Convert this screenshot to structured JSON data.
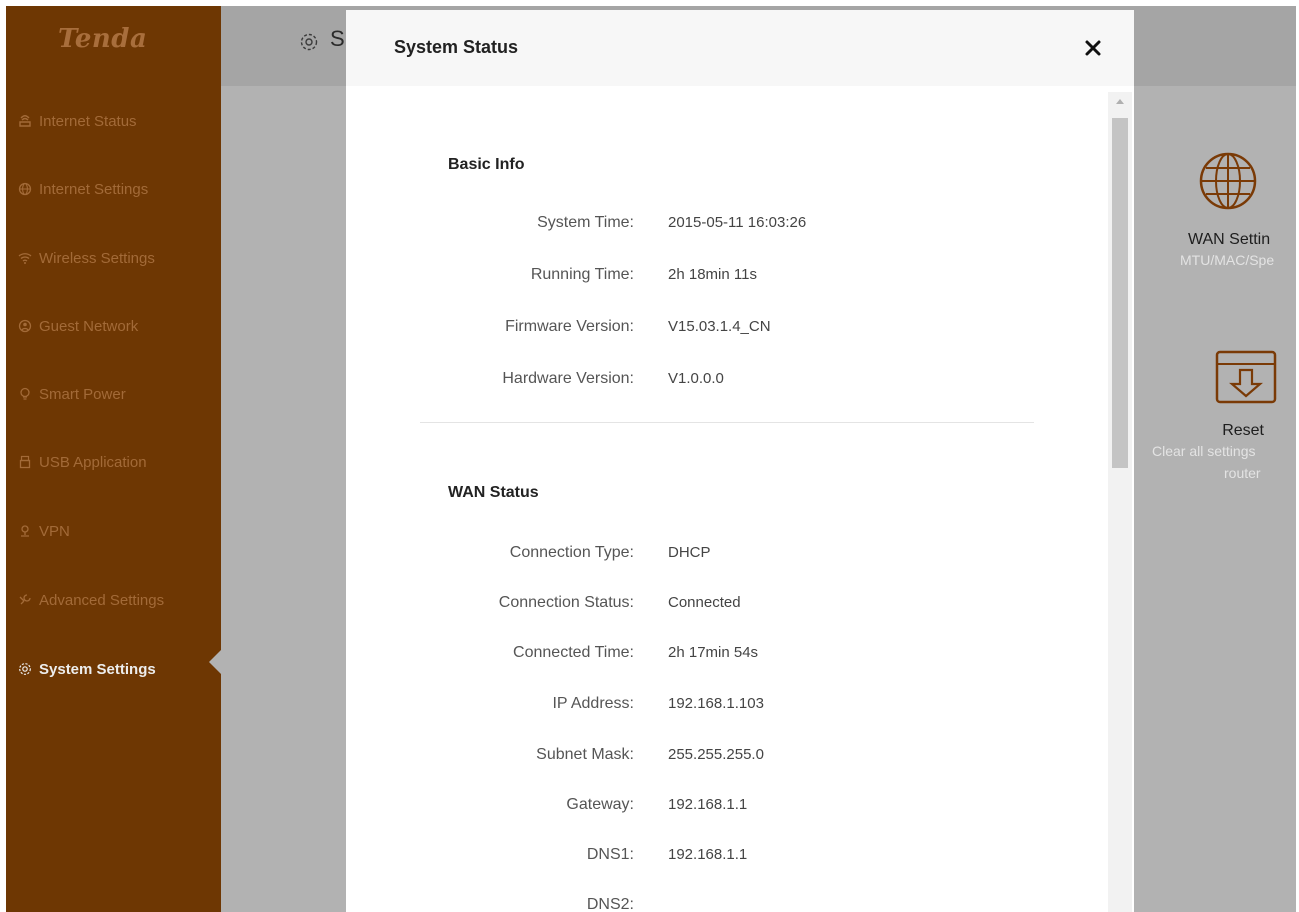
{
  "brand": {
    "logo_text": "Tenda"
  },
  "sidebar": {
    "items": [
      {
        "label": "Internet Status",
        "icon": "router-icon",
        "active": false
      },
      {
        "label": "Internet Settings",
        "icon": "globe-icon",
        "active": false
      },
      {
        "label": "Wireless Settings",
        "icon": "wifi-icon",
        "active": false
      },
      {
        "label": "Guest Network",
        "icon": "guest-network-icon",
        "active": false
      },
      {
        "label": "Smart Power",
        "icon": "bulb-icon",
        "active": false
      },
      {
        "label": "USB Application",
        "icon": "usb-icon",
        "active": false
      },
      {
        "label": "VPN",
        "icon": "vpn-icon",
        "active": false
      },
      {
        "label": "Advanced Settings",
        "icon": "wrench-icon",
        "active": false
      },
      {
        "label": "System Settings",
        "icon": "gear-icon",
        "active": true
      }
    ]
  },
  "page": {
    "title_partial": "S"
  },
  "tiles": [
    {
      "title": "WAN Settin",
      "subtitle": "MTU/MAC/Spe",
      "icon": "globe-icon"
    },
    {
      "title": "Reset",
      "subtitle_line1": "Clear all settings",
      "subtitle_line2": "router",
      "icon": "reset-icon"
    }
  ],
  "modal": {
    "title": "System Status",
    "close_icon": "close-icon",
    "basic_info": {
      "title": "Basic Info",
      "rows": [
        {
          "label": "System Time:",
          "value": "2015-05-11 16:03:26"
        },
        {
          "label": "Running Time:",
          "value": "2h 18min 11s"
        },
        {
          "label": "Firmware Version:",
          "value": "V15.03.1.4_CN"
        },
        {
          "label": "Hardware Version:",
          "value": "V1.0.0.0"
        }
      ]
    },
    "wan_status": {
      "title": "WAN Status",
      "rows": [
        {
          "label": "Connection Type:",
          "value": "DHCP"
        },
        {
          "label": "Connection Status:",
          "value": "Connected"
        },
        {
          "label": "Connected Time:",
          "value": "2h 17min 54s"
        },
        {
          "label": "IP Address:",
          "value": "192.168.1.103"
        },
        {
          "label": "Subnet Mask:",
          "value": "255.255.255.0"
        },
        {
          "label": "Gateway:",
          "value": "192.168.1.1"
        },
        {
          "label": "DNS1:",
          "value": "192.168.1.1"
        },
        {
          "label": "DNS2:",
          "value": ""
        }
      ]
    }
  },
  "colors": {
    "sidebar_bg": "#6e3703",
    "sidebar_text": "#a26a38",
    "overlay": "#b2b2b2",
    "modal_header_bg": "#f7f7f7"
  }
}
